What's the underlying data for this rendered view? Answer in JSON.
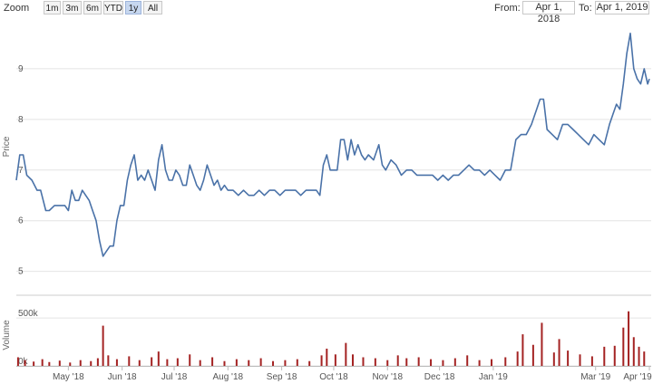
{
  "toolbar": {
    "zoom_label": "Zoom",
    "buttons": [
      {
        "label": "1m",
        "active": false
      },
      {
        "label": "3m",
        "active": false
      },
      {
        "label": "6m",
        "active": false
      },
      {
        "label": "YTD",
        "active": false
      },
      {
        "label": "1y",
        "active": true
      },
      {
        "label": "All",
        "active": false
      }
    ],
    "from_label": "From:",
    "from_value": "Apr 1, 2018",
    "to_label": "To:",
    "to_value": "Apr 1, 2019"
  },
  "colors": {
    "price_line": "#4a72a8",
    "volume_bar": "#a42323",
    "grid": "#e4e4e4"
  },
  "chart_data": [
    {
      "type": "line",
      "ylabel": "Price",
      "ylim": [
        4.6,
        10.0
      ],
      "yticks": [
        5,
        6,
        7,
        8,
        9
      ],
      "xlim": [
        "2018-04-01",
        "2019-04-01"
      ],
      "grid": true,
      "x_tick_labels": [
        {
          "label": "May '18",
          "date": "2018-05-01"
        },
        {
          "label": "Jun '18",
          "date": "2018-06-01"
        },
        {
          "label": "Jul '18",
          "date": "2018-07-01"
        },
        {
          "label": "Aug '18",
          "date": "2018-08-01"
        },
        {
          "label": "Sep '18",
          "date": "2018-09-01"
        },
        {
          "label": "Oct '18",
          "date": "2018-10-01"
        },
        {
          "label": "Nov '18",
          "date": "2018-11-01"
        },
        {
          "label": "Dec '18",
          "date": "2018-12-01"
        },
        {
          "label": "Jan '19",
          "date": "2019-01-01"
        },
        {
          "label": "Mar '19",
          "date": "2019-03-01"
        },
        {
          "label": "Apr '19",
          "date": "2019-04-01"
        }
      ],
      "series": [
        {
          "points": [
            [
              "2018-04-01",
              6.8
            ],
            [
              "2018-04-03",
              7.3
            ],
            [
              "2018-04-05",
              7.3
            ],
            [
              "2018-04-07",
              6.9
            ],
            [
              "2018-04-10",
              6.8
            ],
            [
              "2018-04-13",
              6.6
            ],
            [
              "2018-04-15",
              6.6
            ],
            [
              "2018-04-18",
              6.2
            ],
            [
              "2018-04-20",
              6.2
            ],
            [
              "2018-04-23",
              6.3
            ],
            [
              "2018-04-25",
              6.3
            ],
            [
              "2018-04-27",
              6.3
            ],
            [
              "2018-04-29",
              6.3
            ],
            [
              "2018-05-01",
              6.2
            ],
            [
              "2018-05-03",
              6.6
            ],
            [
              "2018-05-05",
              6.4
            ],
            [
              "2018-05-07",
              6.4
            ],
            [
              "2018-05-09",
              6.6
            ],
            [
              "2018-05-11",
              6.5
            ],
            [
              "2018-05-13",
              6.4
            ],
            [
              "2018-05-15",
              6.2
            ],
            [
              "2018-05-17",
              6.0
            ],
            [
              "2018-05-19",
              5.6
            ],
            [
              "2018-05-21",
              5.3
            ],
            [
              "2018-05-23",
              5.4
            ],
            [
              "2018-05-25",
              5.5
            ],
            [
              "2018-05-27",
              5.5
            ],
            [
              "2018-05-29",
              6.0
            ],
            [
              "2018-05-31",
              6.3
            ],
            [
              "2018-06-02",
              6.3
            ],
            [
              "2018-06-04",
              6.8
            ],
            [
              "2018-06-06",
              7.1
            ],
            [
              "2018-06-08",
              7.3
            ],
            [
              "2018-06-10",
              6.8
            ],
            [
              "2018-06-12",
              6.9
            ],
            [
              "2018-06-14",
              6.8
            ],
            [
              "2018-06-16",
              7.0
            ],
            [
              "2018-06-18",
              6.8
            ],
            [
              "2018-06-20",
              6.6
            ],
            [
              "2018-06-22",
              7.2
            ],
            [
              "2018-06-24",
              7.5
            ],
            [
              "2018-06-26",
              7.0
            ],
            [
              "2018-06-28",
              6.8
            ],
            [
              "2018-06-30",
              6.8
            ],
            [
              "2018-07-02",
              7.0
            ],
            [
              "2018-07-04",
              6.9
            ],
            [
              "2018-07-06",
              6.7
            ],
            [
              "2018-07-08",
              6.7
            ],
            [
              "2018-07-10",
              7.1
            ],
            [
              "2018-07-12",
              6.9
            ],
            [
              "2018-07-14",
              6.7
            ],
            [
              "2018-07-16",
              6.6
            ],
            [
              "2018-07-18",
              6.8
            ],
            [
              "2018-07-20",
              7.1
            ],
            [
              "2018-07-22",
              6.9
            ],
            [
              "2018-07-24",
              6.7
            ],
            [
              "2018-07-26",
              6.8
            ],
            [
              "2018-07-28",
              6.6
            ],
            [
              "2018-07-30",
              6.7
            ],
            [
              "2018-08-01",
              6.6
            ],
            [
              "2018-08-04",
              6.6
            ],
            [
              "2018-08-07",
              6.5
            ],
            [
              "2018-08-10",
              6.6
            ],
            [
              "2018-08-13",
              6.5
            ],
            [
              "2018-08-16",
              6.5
            ],
            [
              "2018-08-19",
              6.6
            ],
            [
              "2018-08-22",
              6.5
            ],
            [
              "2018-08-25",
              6.6
            ],
            [
              "2018-08-28",
              6.6
            ],
            [
              "2018-08-31",
              6.5
            ],
            [
              "2018-09-03",
              6.6
            ],
            [
              "2018-09-06",
              6.6
            ],
            [
              "2018-09-09",
              6.6
            ],
            [
              "2018-09-12",
              6.5
            ],
            [
              "2018-09-15",
              6.6
            ],
            [
              "2018-09-18",
              6.6
            ],
            [
              "2018-09-21",
              6.6
            ],
            [
              "2018-09-23",
              6.5
            ],
            [
              "2018-09-25",
              7.1
            ],
            [
              "2018-09-27",
              7.3
            ],
            [
              "2018-09-29",
              7.0
            ],
            [
              "2018-10-01",
              7.0
            ],
            [
              "2018-10-03",
              7.0
            ],
            [
              "2018-10-05",
              7.6
            ],
            [
              "2018-10-07",
              7.6
            ],
            [
              "2018-10-09",
              7.2
            ],
            [
              "2018-10-11",
              7.6
            ],
            [
              "2018-10-13",
              7.3
            ],
            [
              "2018-10-15",
              7.5
            ],
            [
              "2018-10-17",
              7.3
            ],
            [
              "2018-10-19",
              7.2
            ],
            [
              "2018-10-21",
              7.3
            ],
            [
              "2018-10-24",
              7.2
            ],
            [
              "2018-10-27",
              7.5
            ],
            [
              "2018-10-29",
              7.1
            ],
            [
              "2018-10-31",
              7.0
            ],
            [
              "2018-11-03",
              7.2
            ],
            [
              "2018-11-06",
              7.1
            ],
            [
              "2018-11-09",
              6.9
            ],
            [
              "2018-11-12",
              7.0
            ],
            [
              "2018-11-15",
              7.0
            ],
            [
              "2018-11-18",
              6.9
            ],
            [
              "2018-11-21",
              6.9
            ],
            [
              "2018-11-24",
              6.9
            ],
            [
              "2018-11-27",
              6.9
            ],
            [
              "2018-11-30",
              6.8
            ],
            [
              "2018-12-03",
              6.9
            ],
            [
              "2018-12-06",
              6.8
            ],
            [
              "2018-12-09",
              6.9
            ],
            [
              "2018-12-12",
              6.9
            ],
            [
              "2018-12-15",
              7.0
            ],
            [
              "2018-12-18",
              7.1
            ],
            [
              "2018-12-21",
              7.0
            ],
            [
              "2018-12-24",
              7.0
            ],
            [
              "2018-12-27",
              6.9
            ],
            [
              "2018-12-30",
              7.0
            ],
            [
              "2019-01-02",
              6.9
            ],
            [
              "2019-01-05",
              6.8
            ],
            [
              "2019-01-08",
              7.0
            ],
            [
              "2019-01-11",
              7.0
            ],
            [
              "2019-01-14",
              7.6
            ],
            [
              "2019-01-17",
              7.7
            ],
            [
              "2019-01-20",
              7.7
            ],
            [
              "2019-01-23",
              7.9
            ],
            [
              "2019-01-26",
              8.2
            ],
            [
              "2019-01-28",
              8.4
            ],
            [
              "2019-01-30",
              8.4
            ],
            [
              "2019-02-01",
              7.8
            ],
            [
              "2019-02-04",
              7.7
            ],
            [
              "2019-02-07",
              7.6
            ],
            [
              "2019-02-10",
              7.9
            ],
            [
              "2019-02-13",
              7.9
            ],
            [
              "2019-02-16",
              7.8
            ],
            [
              "2019-02-19",
              7.7
            ],
            [
              "2019-02-22",
              7.6
            ],
            [
              "2019-02-25",
              7.5
            ],
            [
              "2019-02-28",
              7.7
            ],
            [
              "2019-03-03",
              7.6
            ],
            [
              "2019-03-06",
              7.5
            ],
            [
              "2019-03-09",
              7.9
            ],
            [
              "2019-03-11",
              8.1
            ],
            [
              "2019-03-13",
              8.3
            ],
            [
              "2019-03-15",
              8.2
            ],
            [
              "2019-03-17",
              8.7
            ],
            [
              "2019-03-19",
              9.3
            ],
            [
              "2019-03-21",
              9.7
            ],
            [
              "2019-03-23",
              9.0
            ],
            [
              "2019-03-25",
              8.8
            ],
            [
              "2019-03-27",
              8.7
            ],
            [
              "2019-03-29",
              9.0
            ],
            [
              "2019-03-31",
              8.7
            ],
            [
              "2019-04-01",
              8.8
            ]
          ]
        }
      ]
    },
    {
      "type": "bar",
      "ylabel": "Volume",
      "ylim": [
        0,
        700000
      ],
      "yticks": [
        {
          "label": "0k",
          "value": 0
        },
        {
          "label": "500k",
          "value": 500000
        }
      ],
      "series": [
        {
          "points": [
            [
              "2018-04-02",
              90000
            ],
            [
              "2018-04-06",
              60000
            ],
            [
              "2018-04-11",
              45000
            ],
            [
              "2018-04-16",
              70000
            ],
            [
              "2018-04-20",
              40000
            ],
            [
              "2018-04-26",
              55000
            ],
            [
              "2018-05-02",
              35000
            ],
            [
              "2018-05-08",
              60000
            ],
            [
              "2018-05-14",
              50000
            ],
            [
              "2018-05-18",
              80000
            ],
            [
              "2018-05-21",
              420000
            ],
            [
              "2018-05-24",
              110000
            ],
            [
              "2018-05-29",
              70000
            ],
            [
              "2018-06-05",
              100000
            ],
            [
              "2018-06-11",
              60000
            ],
            [
              "2018-06-18",
              90000
            ],
            [
              "2018-06-22",
              150000
            ],
            [
              "2018-06-27",
              70000
            ],
            [
              "2018-07-03",
              80000
            ],
            [
              "2018-07-10",
              120000
            ],
            [
              "2018-07-16",
              60000
            ],
            [
              "2018-07-23",
              90000
            ],
            [
              "2018-07-30",
              50000
            ],
            [
              "2018-08-06",
              70000
            ],
            [
              "2018-08-13",
              60000
            ],
            [
              "2018-08-20",
              80000
            ],
            [
              "2018-08-27",
              50000
            ],
            [
              "2018-09-03",
              60000
            ],
            [
              "2018-09-10",
              70000
            ],
            [
              "2018-09-17",
              50000
            ],
            [
              "2018-09-24",
              110000
            ],
            [
              "2018-09-27",
              180000
            ],
            [
              "2018-10-02",
              120000
            ],
            [
              "2018-10-08",
              240000
            ],
            [
              "2018-10-12",
              120000
            ],
            [
              "2018-10-18",
              90000
            ],
            [
              "2018-10-25",
              80000
            ],
            [
              "2018-11-01",
              60000
            ],
            [
              "2018-11-07",
              110000
            ],
            [
              "2018-11-12",
              80000
            ],
            [
              "2018-11-19",
              90000
            ],
            [
              "2018-11-26",
              70000
            ],
            [
              "2018-12-03",
              60000
            ],
            [
              "2018-12-10",
              80000
            ],
            [
              "2018-12-17",
              110000
            ],
            [
              "2018-12-24",
              60000
            ],
            [
              "2018-12-31",
              70000
            ],
            [
              "2019-01-08",
              90000
            ],
            [
              "2019-01-15",
              150000
            ],
            [
              "2019-01-18",
              330000
            ],
            [
              "2019-01-24",
              220000
            ],
            [
              "2019-01-29",
              450000
            ],
            [
              "2019-02-05",
              140000
            ],
            [
              "2019-02-08",
              280000
            ],
            [
              "2019-02-13",
              160000
            ],
            [
              "2019-02-20",
              120000
            ],
            [
              "2019-02-27",
              100000
            ],
            [
              "2019-03-06",
              200000
            ],
            [
              "2019-03-12",
              210000
            ],
            [
              "2019-03-17",
              400000
            ],
            [
              "2019-03-20",
              570000
            ],
            [
              "2019-03-23",
              300000
            ],
            [
              "2019-03-26",
              200000
            ],
            [
              "2019-03-29",
              150000
            ]
          ]
        }
      ]
    }
  ]
}
